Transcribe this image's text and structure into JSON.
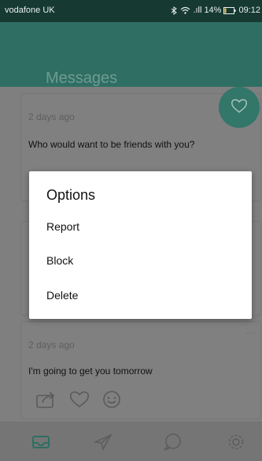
{
  "status_bar": {
    "carrier": "vodafone UK",
    "signal_text": ".ıll",
    "battery_percent": "14%",
    "time": "09:12"
  },
  "header": {
    "title": "Messages"
  },
  "messages": [
    {
      "time": "2 days ago",
      "text": "Who would want to be friends with you?"
    },
    {
      "time": "2 days ago",
      "text": "I'm going to get you tomorrow",
      "more": "..."
    }
  ],
  "dialog": {
    "title": "Options",
    "options": [
      "Report",
      "Block",
      "Delete"
    ]
  },
  "tabs": [
    "inbox-icon",
    "send-icon",
    "chat-icon",
    "gear-icon"
  ],
  "colors": {
    "teal": "#2f6e63",
    "status_bar": "#163932",
    "overlay_gray": "#7f7f7f",
    "active_tab": "#2f6e63"
  }
}
